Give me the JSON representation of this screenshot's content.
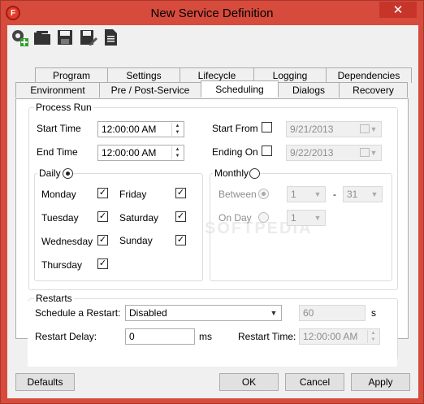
{
  "window": {
    "title": "New Service Definition",
    "close": "✕"
  },
  "toolbar": [
    {
      "name": "add-service-icon"
    },
    {
      "name": "open-folder-icon"
    },
    {
      "name": "save-icon"
    },
    {
      "name": "save-as-icon"
    },
    {
      "name": "document-icon"
    }
  ],
  "tabs_row1": [
    "Program",
    "Settings",
    "Lifecycle",
    "Logging",
    "Dependencies"
  ],
  "tabs_row2": [
    "Environment",
    "Pre / Post-Service",
    "Scheduling",
    "Dialogs",
    "Recovery"
  ],
  "process_run": {
    "title": "Process Run",
    "start_time_label": "Start Time",
    "start_time": "12:00:00 AM",
    "end_time_label": "End Time",
    "end_time": "12:00:00 AM",
    "start_from_label": "Start From",
    "start_from_date": "9/21/2013",
    "ending_on_label": "Ending On",
    "ending_on_date": "9/22/2013",
    "daily_label": "Daily",
    "days": {
      "monday": "Monday",
      "tuesday": "Tuesday",
      "wednesday": "Wednesday",
      "thursday": "Thursday",
      "friday": "Friday",
      "saturday": "Saturday",
      "sunday": "Sunday"
    },
    "monthly_label": "Monthly",
    "between_label": "Between",
    "between_from": "1",
    "between_dash": "-",
    "between_to": "31",
    "on_day_label": "On Day",
    "on_day_value": "1"
  },
  "restarts": {
    "title": "Restarts",
    "schedule_label": "Schedule a Restart:",
    "schedule_value": "Disabled",
    "seconds_value": "60",
    "seconds_unit": "s",
    "delay_label": "Restart Delay:",
    "delay_value": "0",
    "delay_unit": "ms",
    "time_label": "Restart Time:",
    "time_value": "12:00:00 AM"
  },
  "buttons": {
    "defaults": "Defaults",
    "ok": "OK",
    "cancel": "Cancel",
    "apply": "Apply"
  },
  "watermark": "SOFTPEDIA"
}
